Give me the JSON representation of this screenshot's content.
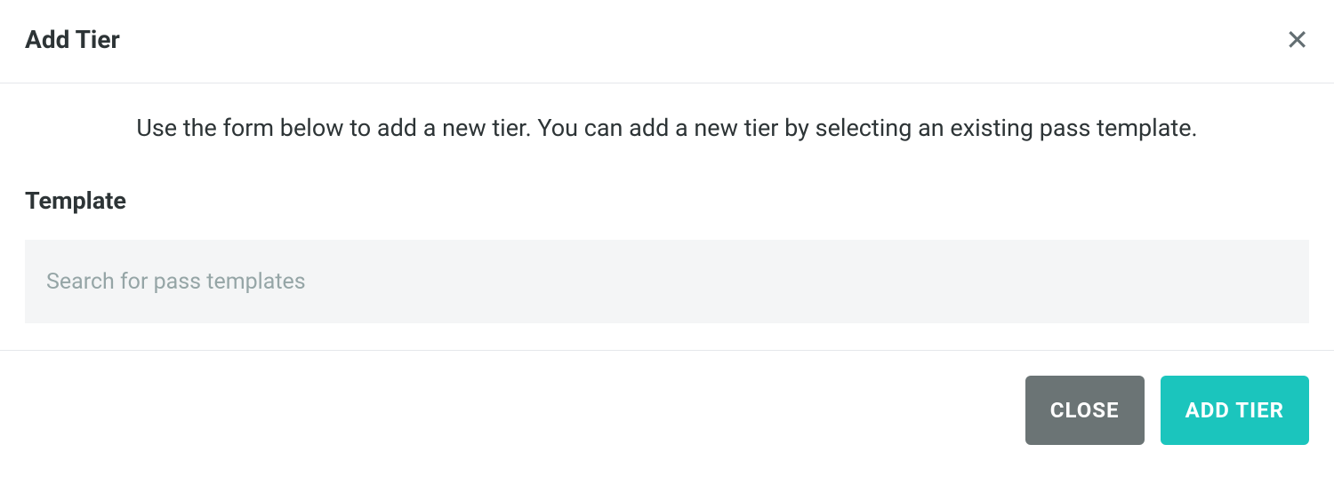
{
  "header": {
    "title": "Add Tier"
  },
  "body": {
    "instruction": "Use the form below to add a new tier. You can add a new tier by selecting an existing pass template.",
    "template_label": "Template",
    "search_placeholder": "Search for pass templates"
  },
  "footer": {
    "close_label": "CLOSE",
    "add_tier_label": "ADD TIER"
  }
}
